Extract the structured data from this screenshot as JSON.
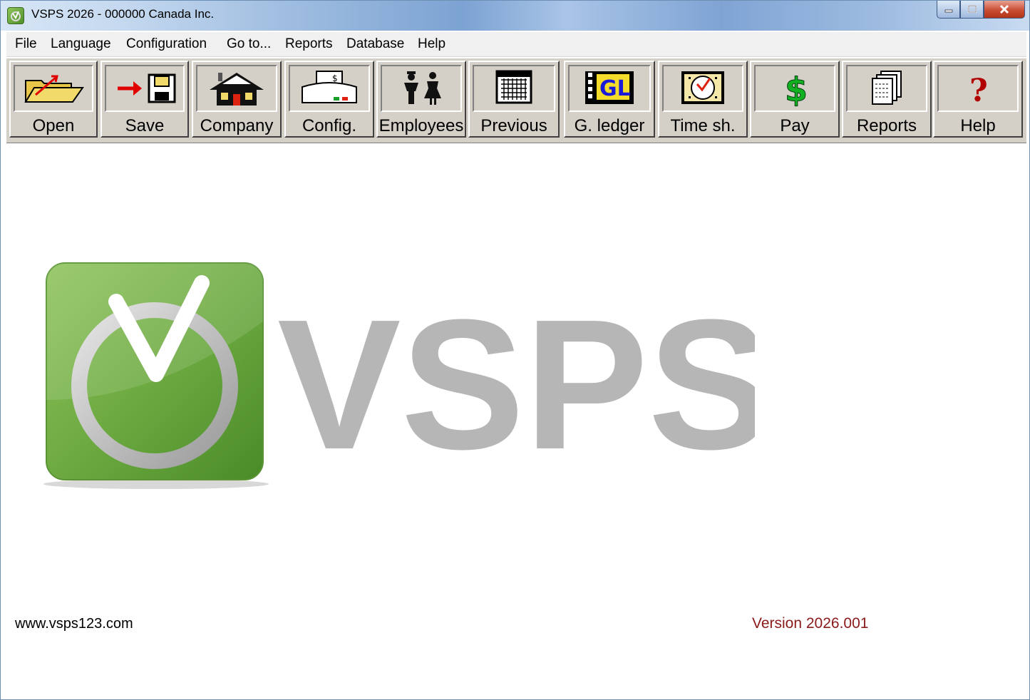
{
  "window": {
    "title": "VSPS 2026 - 000000 Canada Inc."
  },
  "menu": [
    "File",
    "Language",
    "Configuration",
    "Go to...",
    "Reports",
    "Database",
    "Help"
  ],
  "toolbar": [
    {
      "label": "Open",
      "icon": "open-folder-icon"
    },
    {
      "label": "Save",
      "icon": "save-disk-icon"
    },
    {
      "label": "Company",
      "icon": "company-house-icon"
    },
    {
      "label": "Config.",
      "icon": "printer-config-icon"
    },
    {
      "label": "Employees",
      "icon": "employees-people-icon"
    },
    {
      "label": "Previous",
      "icon": "calendar-icon"
    },
    {
      "label": "G. ledger",
      "icon": "general-ledger-icon"
    },
    {
      "label": "Time sh.",
      "icon": "timesheet-clock-icon"
    },
    {
      "label": "Pay",
      "icon": "dollar-sign-icon"
    },
    {
      "label": "Reports",
      "icon": "reports-documents-icon"
    },
    {
      "label": "Help",
      "icon": "help-question-icon"
    }
  ],
  "logo": {
    "text": "VSPS"
  },
  "footer": {
    "website": "www.vsps123.com",
    "version": "Version 2026.001"
  },
  "colors": {
    "version_text": "#8b1a1a",
    "logo_green": "#6aa83f",
    "logo_gray": "#8f8f8f",
    "toolbar_bg": "#d4d0c8"
  }
}
